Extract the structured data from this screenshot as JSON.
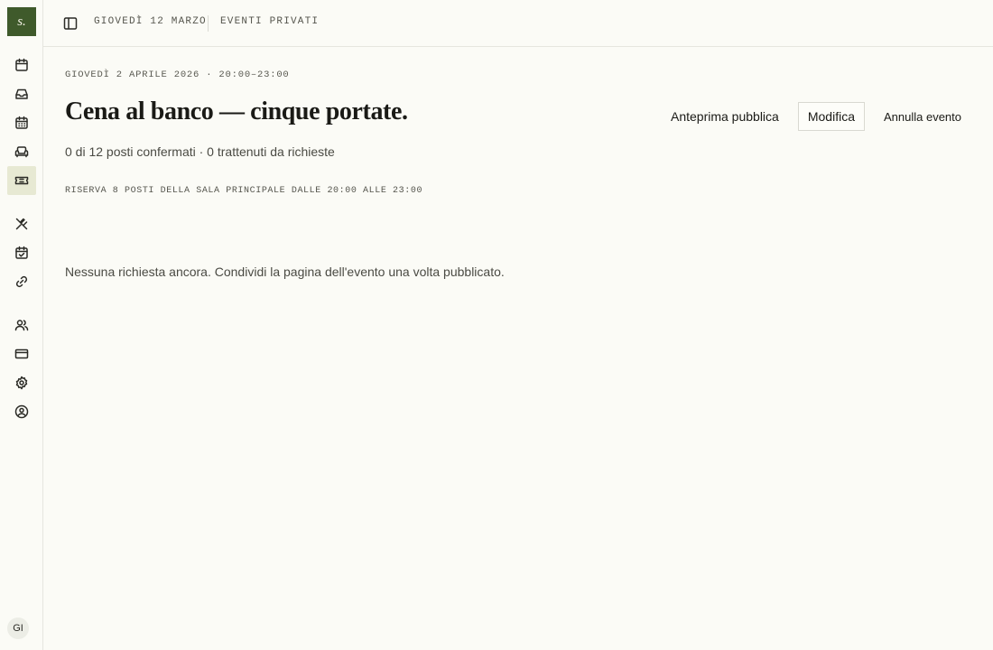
{
  "sidebar": {
    "logo": "s.",
    "items": [
      {
        "icon": "calendar-icon",
        "active": false
      },
      {
        "icon": "inbox-icon",
        "active": false
      },
      {
        "icon": "calendar-grid-icon",
        "active": false
      },
      {
        "icon": "sofa-icon",
        "active": false
      },
      {
        "icon": "ticket-icon",
        "active": true
      },
      {
        "icon": "utensils-icon",
        "active": false
      },
      {
        "icon": "calendar-check-icon",
        "active": false
      },
      {
        "icon": "link-icon",
        "active": false
      },
      {
        "icon": "users-icon",
        "active": false
      },
      {
        "icon": "credit-card-icon",
        "active": false
      },
      {
        "icon": "gear-icon",
        "active": false
      },
      {
        "icon": "user-circle-icon",
        "active": false
      }
    ],
    "avatar": "GI"
  },
  "topbar": {
    "date": "GIOVEDÌ 12 MARZO",
    "section": "EVENTI PRIVATI"
  },
  "event": {
    "eyebrow": "GIOVEDÌ 2 APRILE 2026 · 20:00–23:00",
    "title": "Cena al banco — cinque portate.",
    "summary": "0 di 12 posti confermati · 0 trattenuti da richieste",
    "reservation_note": "RISERVA 8 POSTI DELLA SALA PRINCIPALE DALLE 20:00 ALLE 23:00",
    "empty_state": "Nessuna richiesta ancora. Condividi la pagina dell'evento una volta pubblicato."
  },
  "actions": {
    "preview": "Anteprima pubblica",
    "edit": "Modifica",
    "cancel": "Annulla evento"
  },
  "colors": {
    "brand": "#3f5a2b",
    "active_bg": "#e7e9d3",
    "background": "#fbfbf6"
  }
}
